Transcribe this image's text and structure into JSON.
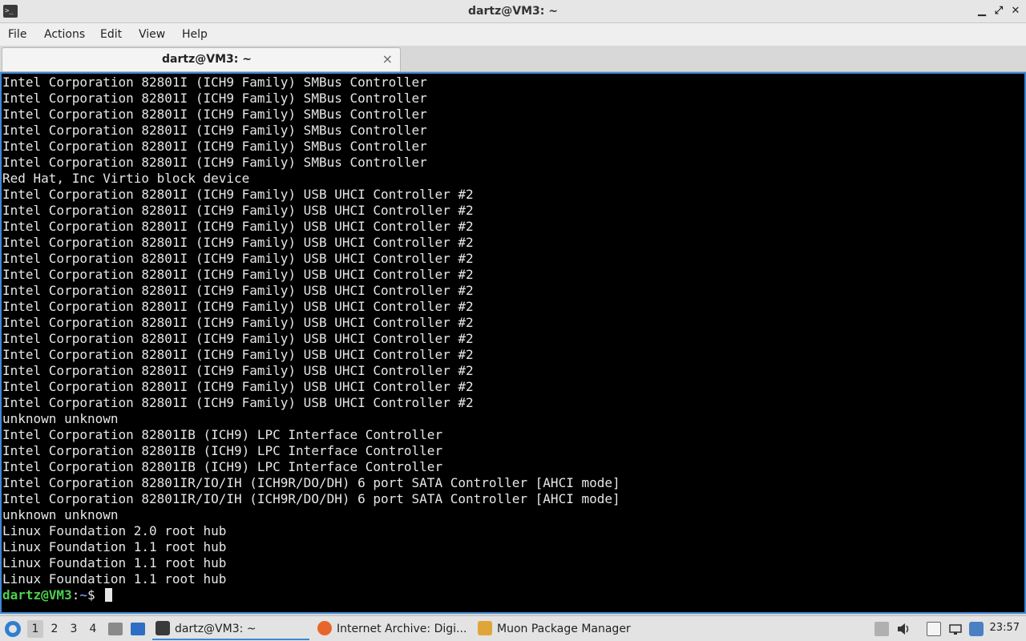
{
  "window": {
    "title": "dartz@VM3: ~",
    "icon": "terminal-icon",
    "controls": {
      "minimize": "▁",
      "maximize": "⤢",
      "close": "✕"
    }
  },
  "menubar": [
    "File",
    "Actions",
    "Edit",
    "View",
    "Help"
  ],
  "tab": {
    "label": "dartz@VM3: ~",
    "close": "×"
  },
  "terminal": {
    "lines": [
      "Intel Corporation 82801I (ICH9 Family) SMBus Controller",
      "Intel Corporation 82801I (ICH9 Family) SMBus Controller",
      "Intel Corporation 82801I (ICH9 Family) SMBus Controller",
      "Intel Corporation 82801I (ICH9 Family) SMBus Controller",
      "Intel Corporation 82801I (ICH9 Family) SMBus Controller",
      "Intel Corporation 82801I (ICH9 Family) SMBus Controller",
      "Red Hat, Inc Virtio block device",
      "Intel Corporation 82801I (ICH9 Family) USB UHCI Controller #2",
      "Intel Corporation 82801I (ICH9 Family) USB UHCI Controller #2",
      "Intel Corporation 82801I (ICH9 Family) USB UHCI Controller #2",
      "Intel Corporation 82801I (ICH9 Family) USB UHCI Controller #2",
      "Intel Corporation 82801I (ICH9 Family) USB UHCI Controller #2",
      "Intel Corporation 82801I (ICH9 Family) USB UHCI Controller #2",
      "Intel Corporation 82801I (ICH9 Family) USB UHCI Controller #2",
      "Intel Corporation 82801I (ICH9 Family) USB UHCI Controller #2",
      "Intel Corporation 82801I (ICH9 Family) USB UHCI Controller #2",
      "Intel Corporation 82801I (ICH9 Family) USB UHCI Controller #2",
      "Intel Corporation 82801I (ICH9 Family) USB UHCI Controller #2",
      "Intel Corporation 82801I (ICH9 Family) USB UHCI Controller #2",
      "Intel Corporation 82801I (ICH9 Family) USB UHCI Controller #2",
      "Intel Corporation 82801I (ICH9 Family) USB UHCI Controller #2",
      "unknown unknown",
      "Intel Corporation 82801IB (ICH9) LPC Interface Controller",
      "Intel Corporation 82801IB (ICH9) LPC Interface Controller",
      "Intel Corporation 82801IB (ICH9) LPC Interface Controller",
      "Intel Corporation 82801IR/IO/IH (ICH9R/DO/DH) 6 port SATA Controller [AHCI mode]",
      "Intel Corporation 82801IR/IO/IH (ICH9R/DO/DH) 6 port SATA Controller [AHCI mode]",
      "unknown unknown",
      "Linux Foundation 2.0 root hub",
      "Linux Foundation 1.1 root hub",
      "Linux Foundation 1.1 root hub",
      "Linux Foundation 1.1 root hub"
    ],
    "prompt": {
      "user": "dartz@VM3",
      "sep": ":",
      "path": "~",
      "symbol": "$ "
    },
    "colors": {
      "background": "#000000",
      "text": "#e6e6e6",
      "prompt_user": "#4ecf4e",
      "prompt_path": "#5c8ee8",
      "focus_border": "#3d88d6"
    }
  },
  "taskbar": {
    "start_icon": "lxqt-start-icon",
    "workspaces": [
      "1",
      "2",
      "3",
      "4"
    ],
    "active_workspace": "1",
    "tasks": [
      {
        "label": "dartz@VM3: ~",
        "icon": "terminal-icon",
        "active": true
      },
      {
        "label": "Internet Archive: Digi...",
        "icon": "firefox-icon",
        "active": false
      },
      {
        "label": "Muon Package Manager",
        "icon": "package-manager-icon",
        "active": false
      }
    ],
    "clock": "23:57"
  }
}
